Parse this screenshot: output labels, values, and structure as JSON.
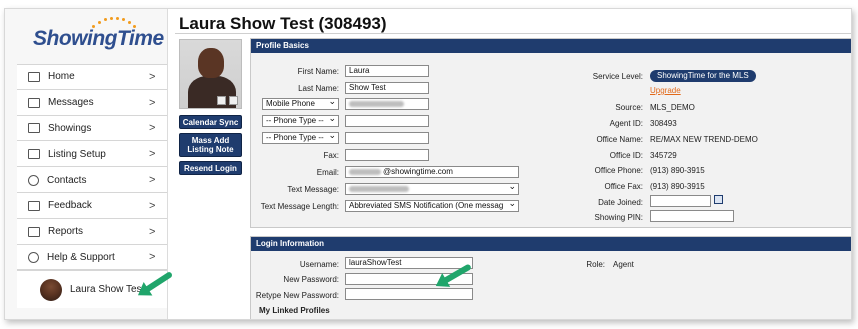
{
  "app": {
    "logo_text": "ShowingTime",
    "page_title": "Laura Show Test (308493)"
  },
  "sidebar": {
    "items": [
      {
        "label": "Home",
        "icon": "home-icon"
      },
      {
        "label": "Messages",
        "icon": "envelope-icon"
      },
      {
        "label": "Showings",
        "icon": "calendar-icon"
      },
      {
        "label": "Listing Setup",
        "icon": "flag-icon"
      },
      {
        "label": "Contacts",
        "icon": "contacts-icon"
      },
      {
        "label": "Feedback",
        "icon": "clipboard-icon"
      },
      {
        "label": "Reports",
        "icon": "report-icon"
      },
      {
        "label": "Help & Support",
        "icon": "help-icon"
      }
    ],
    "chevron": ">",
    "user_name": "Laura Show Test"
  },
  "actions": {
    "calendar_sync": "Calendar Sync",
    "mass_add_listing_note": "Mass Add Listing Note",
    "resend_login": "Resend Login"
  },
  "profile_basics": {
    "heading": "Profile Basics",
    "first_name_label": "First Name:",
    "first_name": "Laura",
    "last_name_label": "Last Name:",
    "last_name": "Show Test",
    "phone1_type": "Mobile Phone",
    "phone2_type": "-- Phone Type --",
    "phone3_type": "-- Phone Type --",
    "fax_label": "Fax:",
    "email_label": "Email:",
    "email_visible": "@showingtime.com",
    "text_message_label": "Text Message:",
    "text_message_length_label": "Text Message Length:",
    "text_message_length": "Abbreviated SMS Notification (One messag",
    "service_level_label": "Service Level:",
    "service_level": "ShowingTime for the MLS",
    "upgrade_link": "Upgrade",
    "source_label": "Source:",
    "source": "MLS_DEMO",
    "agent_id_label": "Agent ID:",
    "agent_id": "308493",
    "office_name_label": "Office Name:",
    "office_name": "RE/MAX NEW TREND-DEMO",
    "office_id_label": "Office ID:",
    "office_id": "345729",
    "office_phone_label": "Office Phone:",
    "office_phone": "(913) 890-3915",
    "office_fax_label": "Office Fax:",
    "office_fax": "(913) 890-3915",
    "date_joined_label": "Date Joined:",
    "showing_pin_label": "Showing PIN:"
  },
  "login_info": {
    "heading": "Login Information",
    "username_label": "Username:",
    "username": "lauraShowTest",
    "new_password_label": "New Password:",
    "retype_password_label": "Retype New Password:",
    "role_label": "Role:",
    "role": "Agent",
    "linked_profiles_title": "My Linked Profiles"
  },
  "colors": {
    "brand_navy": "#1f3c6e",
    "upgrade_orange": "#e26a1b",
    "arrow_green": "#20a56b"
  }
}
